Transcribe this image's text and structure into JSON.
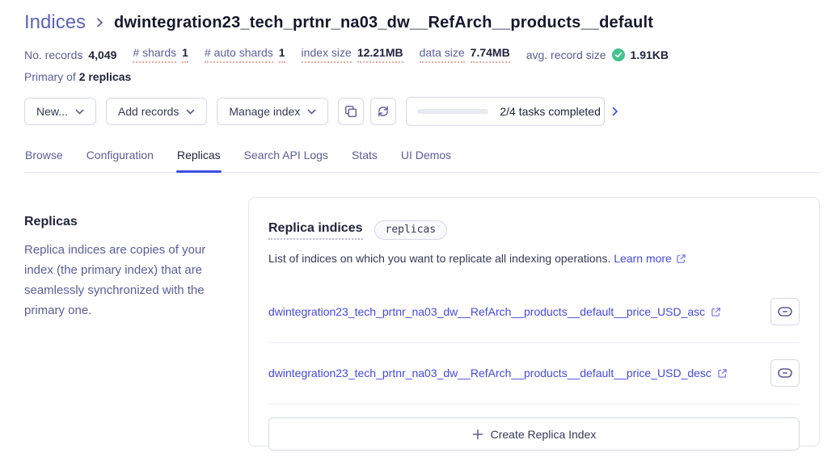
{
  "breadcrumb": {
    "section": "Indices",
    "index_name": "dwintegration23_tech_prtnr_na03_dw__RefArch__products__default"
  },
  "stats": {
    "items": [
      {
        "label": "No. records",
        "value": "4,049"
      },
      {
        "label": "# shards",
        "value": "1"
      },
      {
        "label": "# auto shards",
        "value": "1"
      },
      {
        "label": "index size",
        "value": "12.21MB"
      },
      {
        "label": "data size",
        "value": "7.74MB"
      },
      {
        "label": "avg. record size",
        "value": "1.91KB"
      }
    ],
    "primary_label": "Primary of",
    "primary_value": "2 replicas"
  },
  "toolbar": {
    "new_label": "New...",
    "add_records_label": "Add records",
    "manage_index_label": "Manage index",
    "copy_icon": "copy-icon",
    "refresh_icon": "refresh-icon",
    "tasks": {
      "label": "2/4 tasks completed",
      "completed": 2,
      "total": 4,
      "progress_width": "50%"
    }
  },
  "tabs": [
    {
      "label": "Browse"
    },
    {
      "label": "Configuration"
    },
    {
      "label": "Replicas"
    },
    {
      "label": "Search API Logs"
    },
    {
      "label": "Stats"
    },
    {
      "label": "UI Demos"
    }
  ],
  "sidebar": {
    "heading": "Replicas",
    "description": "Replica indices are copies of your index (the primary index) that are seamlessly synchronized with the primary one."
  },
  "card": {
    "title": "Replica indices",
    "badge": "replicas",
    "description": "List of indices on which you want to replicate all indexing operations.",
    "learn_more_label": "Learn more",
    "replicas": [
      {
        "name": "dwintegration23_tech_prtnr_na03_dw__RefArch__products__default__price_USD_asc"
      },
      {
        "name": "dwintegration23_tech_prtnr_na03_dw__RefArch__products__default__price_USD_desc"
      }
    ],
    "create_label": "Create Replica Index"
  },
  "colors": {
    "accent_blue": "#3c4fe0",
    "link_blue": "#4549e4",
    "breadcrumb_purple": "#5c64b8",
    "label_purple": "#5a5e9a",
    "dark_text": "#21243d",
    "success_green": "#41c48f",
    "dotted_red": "#f0a8a4",
    "border": "#d6d8e7"
  }
}
